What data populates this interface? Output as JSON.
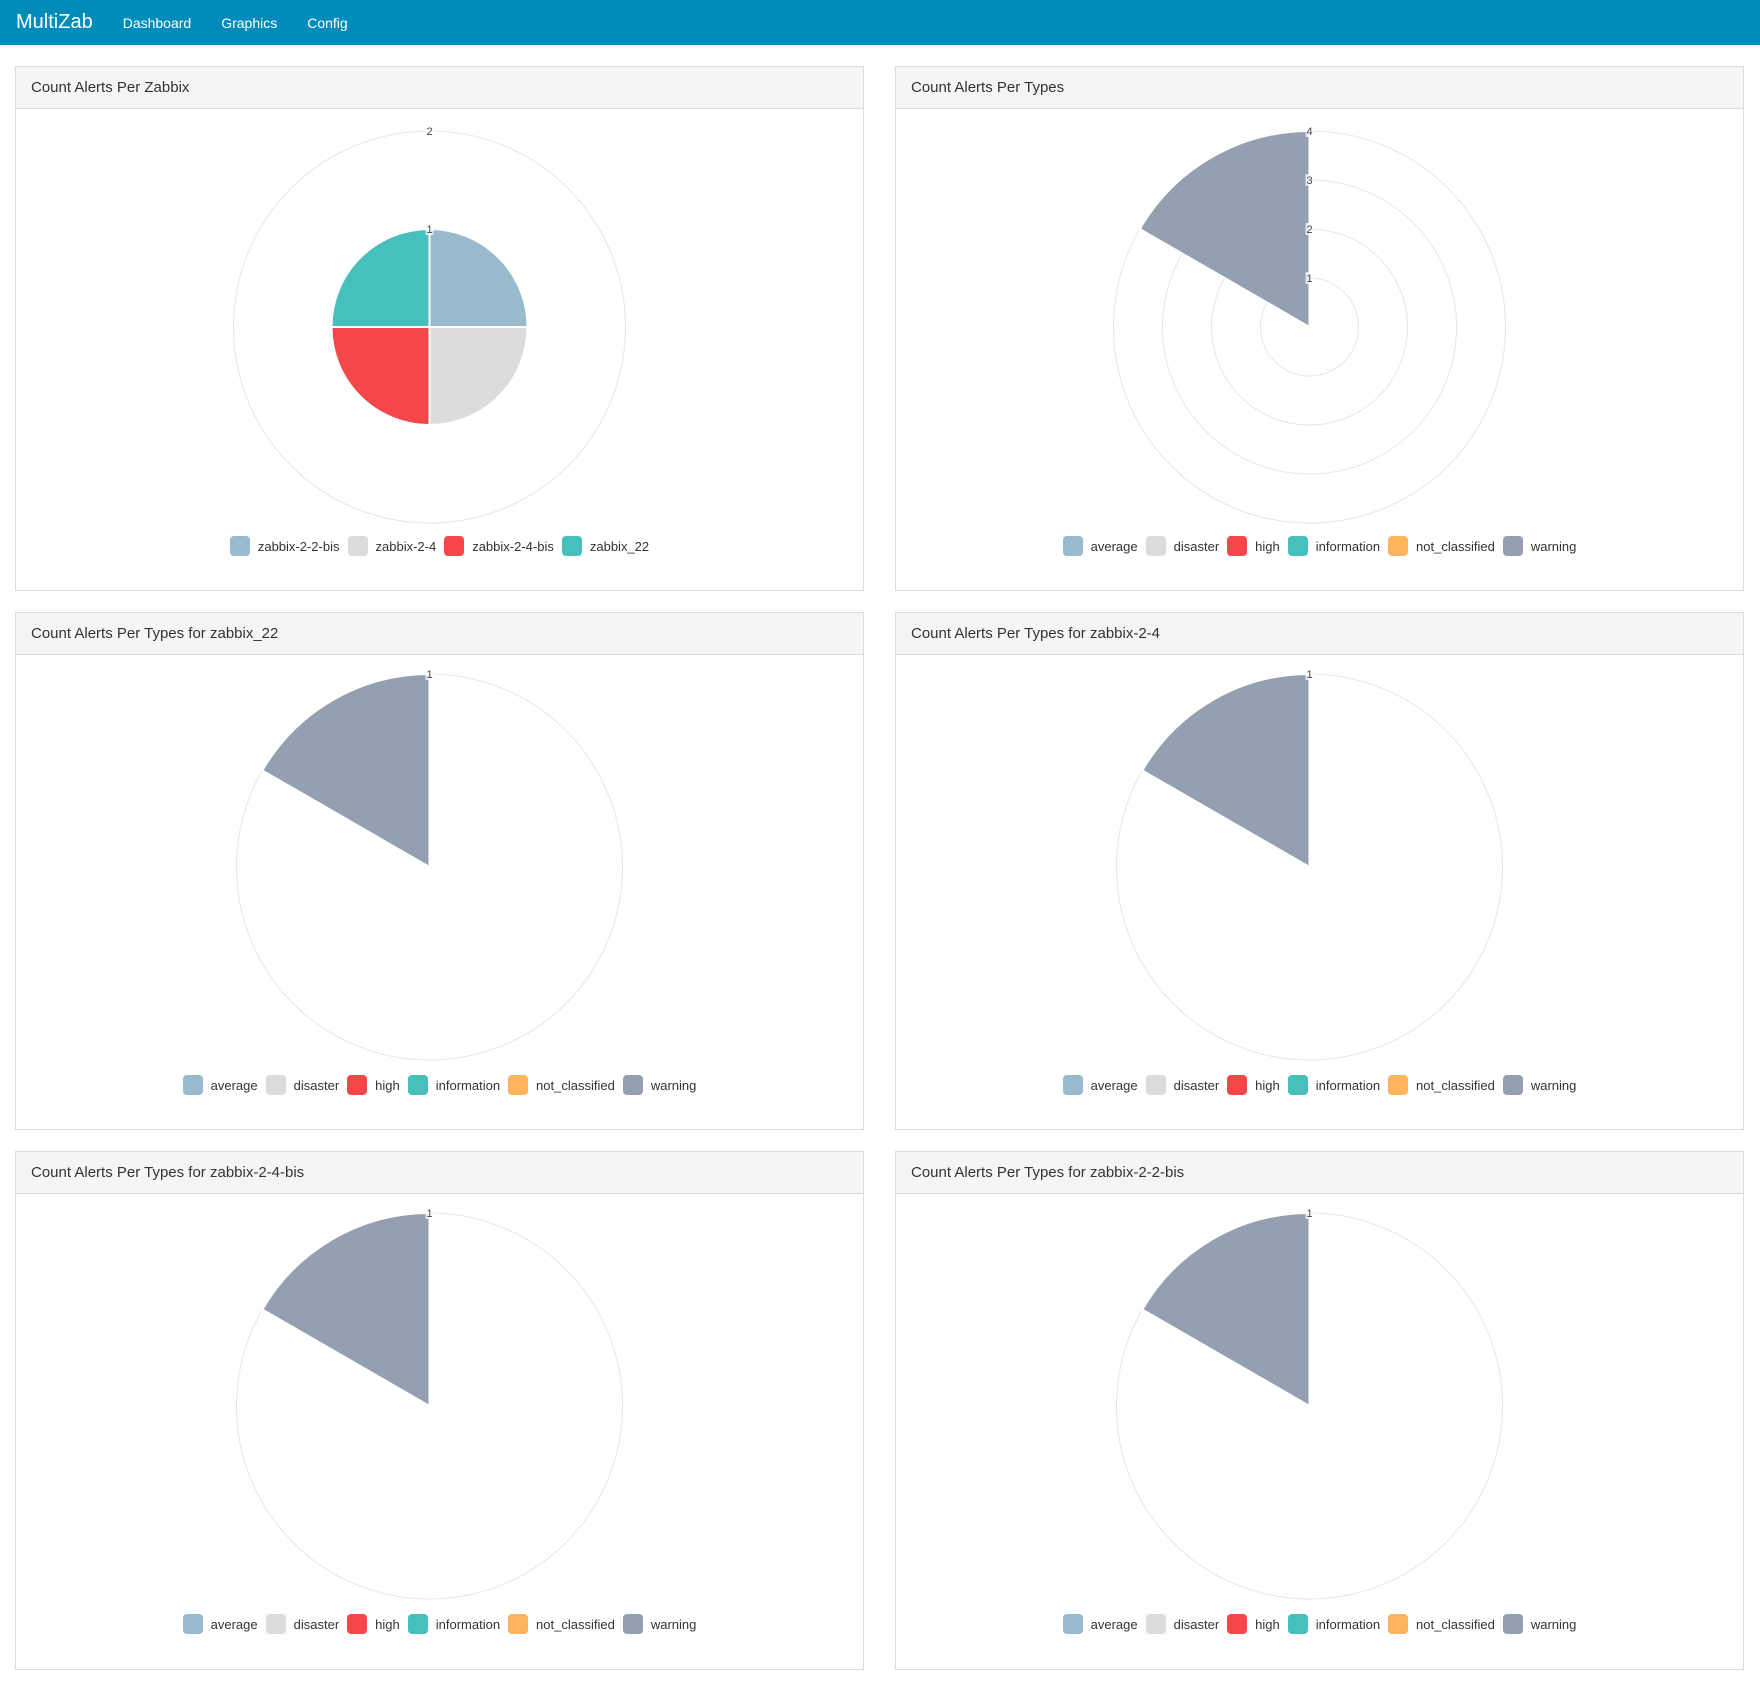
{
  "navbar": {
    "brand": "MultiZab",
    "links": [
      "Dashboard",
      "Graphics",
      "Config"
    ]
  },
  "colors": {
    "navbar_bg": "#008cbb",
    "zabbix-2-2-bis": "#97bbcd",
    "zabbix-2-4": "#dcdcdc",
    "zabbix-2-4-bis": "#f7464a",
    "zabbix_22": "#46bfbd",
    "average": "#97bbcd",
    "disaster": "#dcdcdc",
    "high": "#f7464a",
    "information": "#46bfbd",
    "not_classified": "#fdb45c",
    "warning": "#949fb1"
  },
  "panels": [
    {
      "title": "Count Alerts Per Zabbix"
    },
    {
      "title": "Count Alerts Per Types"
    },
    {
      "title": "Count Alerts Per Types for zabbix_22"
    },
    {
      "title": "Count Alerts Per Types for zabbix-2-4"
    },
    {
      "title": "Count Alerts Per Types for zabbix-2-4-bis"
    },
    {
      "title": "Count Alerts Per Types for zabbix-2-2-bis"
    }
  ],
  "chart_data": [
    {
      "type": "polarArea",
      "title": "Count Alerts Per Zabbix",
      "categories": [
        "zabbix-2-2-bis",
        "zabbix-2-4",
        "zabbix-2-4-bis",
        "zabbix_22"
      ],
      "values": [
        1,
        1,
        1,
        1
      ],
      "rlim": [
        0,
        2
      ],
      "ticks": [
        "1",
        "2"
      ],
      "legend": "bottom"
    },
    {
      "type": "polarArea",
      "title": "Count Alerts Per Types",
      "categories": [
        "average",
        "disaster",
        "high",
        "information",
        "not_classified",
        "warning"
      ],
      "values": [
        0,
        0,
        0,
        0,
        0,
        4
      ],
      "rlim": [
        0,
        4
      ],
      "ticks": [
        "1",
        "2",
        "3",
        "4"
      ],
      "legend": "bottom"
    },
    {
      "type": "polarArea",
      "title": "Count Alerts Per Types for zabbix_22",
      "categories": [
        "average",
        "disaster",
        "high",
        "information",
        "not_classified",
        "warning"
      ],
      "values": [
        0,
        0,
        0,
        0,
        0,
        1
      ],
      "rlim": [
        0,
        1
      ],
      "ticks": [
        "1"
      ],
      "legend": "bottom"
    },
    {
      "type": "polarArea",
      "title": "Count Alerts Per Types for zabbix-2-4",
      "categories": [
        "average",
        "disaster",
        "high",
        "information",
        "not_classified",
        "warning"
      ],
      "values": [
        0,
        0,
        0,
        0,
        0,
        1
      ],
      "rlim": [
        0,
        1
      ],
      "ticks": [
        "1"
      ],
      "legend": "bottom"
    },
    {
      "type": "polarArea",
      "title": "Count Alerts Per Types for zabbix-2-4-bis",
      "categories": [
        "average",
        "disaster",
        "high",
        "information",
        "not_classified",
        "warning"
      ],
      "values": [
        0,
        0,
        0,
        0,
        0,
        1
      ],
      "rlim": [
        0,
        1
      ],
      "ticks": [
        "1"
      ],
      "legend": "bottom"
    },
    {
      "type": "polarArea",
      "title": "Count Alerts Per Types for zabbix-2-2-bis",
      "categories": [
        "average",
        "disaster",
        "high",
        "information",
        "not_classified",
        "warning"
      ],
      "values": [
        0,
        0,
        0,
        0,
        0,
        1
      ],
      "rlim": [
        0,
        1
      ],
      "ticks": [
        "1"
      ],
      "legend": "bottom"
    }
  ]
}
